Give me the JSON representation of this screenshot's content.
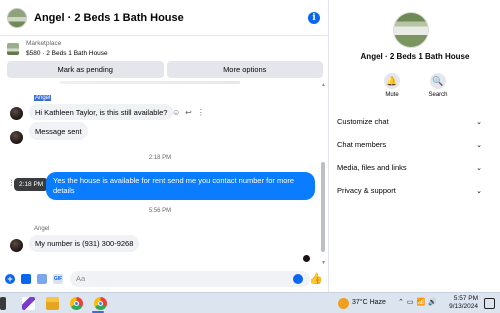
{
  "header": {
    "title": "Angel · 2 Beds 1 Bath House"
  },
  "marketplace": {
    "label": "Marketplace",
    "listing": "$580 · 2 Beds 1 Bath House"
  },
  "actions": {
    "mark_pending": "Mark as pending",
    "more_options": "More options"
  },
  "messages": [
    {
      "sender": "Angel",
      "text": "Hi Kathleen Taylor, is this still available?"
    },
    {
      "text": "Message sent"
    },
    {
      "timestamp": "2:18 PM"
    },
    {
      "text": "Yes the house is available for rent  send me you contact number for more details",
      "tooltip": "2:18 PM"
    },
    {
      "timestamp": "5:56 PM"
    },
    {
      "sender": "Angel",
      "text": "My number is (931) 300-9268"
    }
  ],
  "composer": {
    "placeholder": "Aa"
  },
  "info_panel": {
    "name": "Angel · 2 Beds 1 Bath House",
    "mute_label": "Mute",
    "search_label": "Search",
    "menu": [
      "Customize chat",
      "Chat members",
      "Media, files and links",
      "Privacy & support"
    ]
  },
  "taskbar": {
    "temperature": "37°C",
    "weather": "Haze",
    "time": "5:57 PM",
    "date": "9/13/2024"
  },
  "colors": {
    "accent": "#0a7cff",
    "bubble_in": "#f0f2f5",
    "button_bg": "#e4e6eb"
  }
}
